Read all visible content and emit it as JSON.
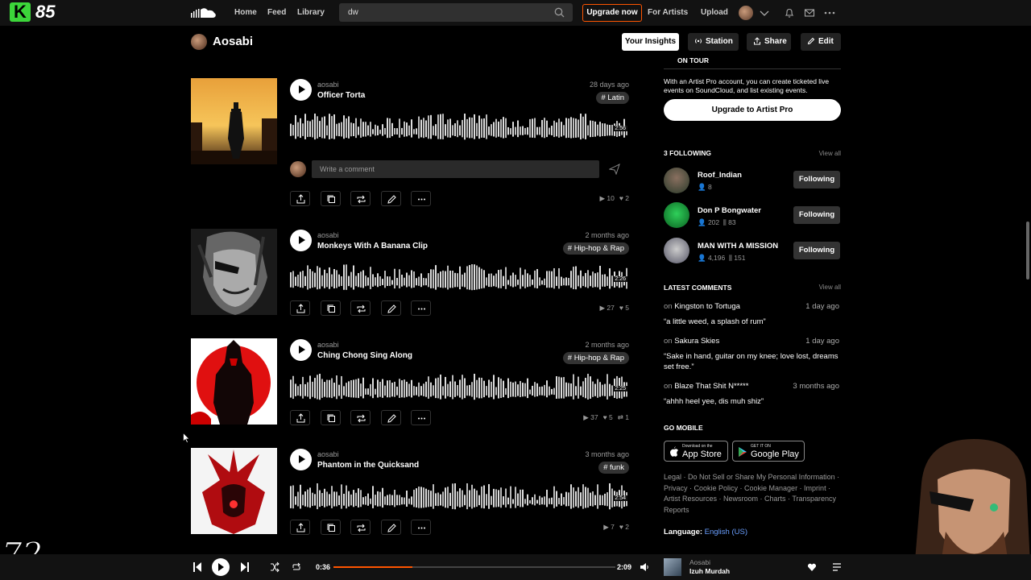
{
  "overlay": {
    "channel_letter": "K",
    "channel_number": "85",
    "corner_number": "72"
  },
  "nav": {
    "home": "Home",
    "feed": "Feed",
    "library": "Library",
    "search_value": "dw",
    "upgrade": "Upgrade now",
    "for_artists": "For Artists",
    "upload": "Upload"
  },
  "header": {
    "title": "Aosabi",
    "buttons": {
      "insights": "Your Insights",
      "station": "Station",
      "share": "Share",
      "edit": "Edit"
    }
  },
  "tracks": [
    {
      "artist": "aosabi",
      "title": "Officer Torta",
      "date": "28 days ago",
      "tag": "# Latin",
      "duration": "2:56",
      "plays": "10",
      "likes": "2",
      "reposts": "",
      "art": "sunset-cowboy"
    },
    {
      "artist": "aosabi",
      "title": "Monkeys With A Banana Clip",
      "date": "2 months ago",
      "tag": "# Hip-hop & Rap",
      "duration": "2:26",
      "plays": "27",
      "likes": "5",
      "reposts": "",
      "art": "eyepatch-sketch"
    },
    {
      "artist": "aosabi",
      "title": "Ching Chong Sing Along",
      "date": "2 months ago",
      "tag": "# Hip-hop & Rap",
      "duration": "2:25",
      "plays": "37",
      "likes": "5",
      "reposts": "1",
      "art": "red-samurai-sun"
    },
    {
      "artist": "aosabi",
      "title": "Phantom in the Quicksand",
      "date": "3 months ago",
      "tag": "# funk",
      "duration": "2:54",
      "plays": "7",
      "likes": "2",
      "reposts": "",
      "art": "red-demon-mask"
    }
  ],
  "comment": {
    "placeholder": "Write a comment"
  },
  "sidebar": {
    "on_tour": "ON TOUR",
    "tour_text": "With an Artist Pro account, you can create ticketed live events on SoundCloud, and list existing events.",
    "upgrade_pro": "Upgrade to Artist Pro",
    "following_head": "3 FOLLOWING",
    "view_all": "View all",
    "following": [
      {
        "name": "Roof_Indian",
        "followers": "8",
        "tracks": "",
        "button": "Following"
      },
      {
        "name": "Don P Bongwater",
        "followers": "202",
        "tracks": "83",
        "button": "Following"
      },
      {
        "name": "MAN WITH A MISSION",
        "followers": "4,196",
        "tracks": "151",
        "button": "Following"
      }
    ],
    "comments_head": "LATEST COMMENTS",
    "comments": [
      {
        "on": "on",
        "track": "Kingston to Tortuga",
        "time": "1 day ago",
        "text": "“a little weed, a splash of rum”"
      },
      {
        "on": "on",
        "track": "Sakura Skies",
        "time": "1 day ago",
        "text": "“Sake in hand, guitar on my knee; love lost, dreams set free.”"
      },
      {
        "on": "on",
        "track": "Blaze That Shit N*****",
        "time": "3 months ago",
        "text": "“ahhh heel yee, dis muh shiz”"
      }
    ],
    "go_mobile": "GO MOBILE",
    "app_store_top": "Download on the",
    "app_store": "App Store",
    "google_play_top": "GET IT ON",
    "google_play": "Google Play",
    "legal": "Legal · Do Not Sell or Share My Personal Information · Privacy · Cookie Policy · Cookie Manager · Imprint · Artist Resources · Newsroom · Charts · Transparency Reports",
    "language_label": "Language:",
    "language": "English (US)"
  },
  "player": {
    "elapsed": "0:36",
    "total": "2:09",
    "progress": 0.28,
    "artist": "Aosabi",
    "title": "Izuh Murdah"
  }
}
